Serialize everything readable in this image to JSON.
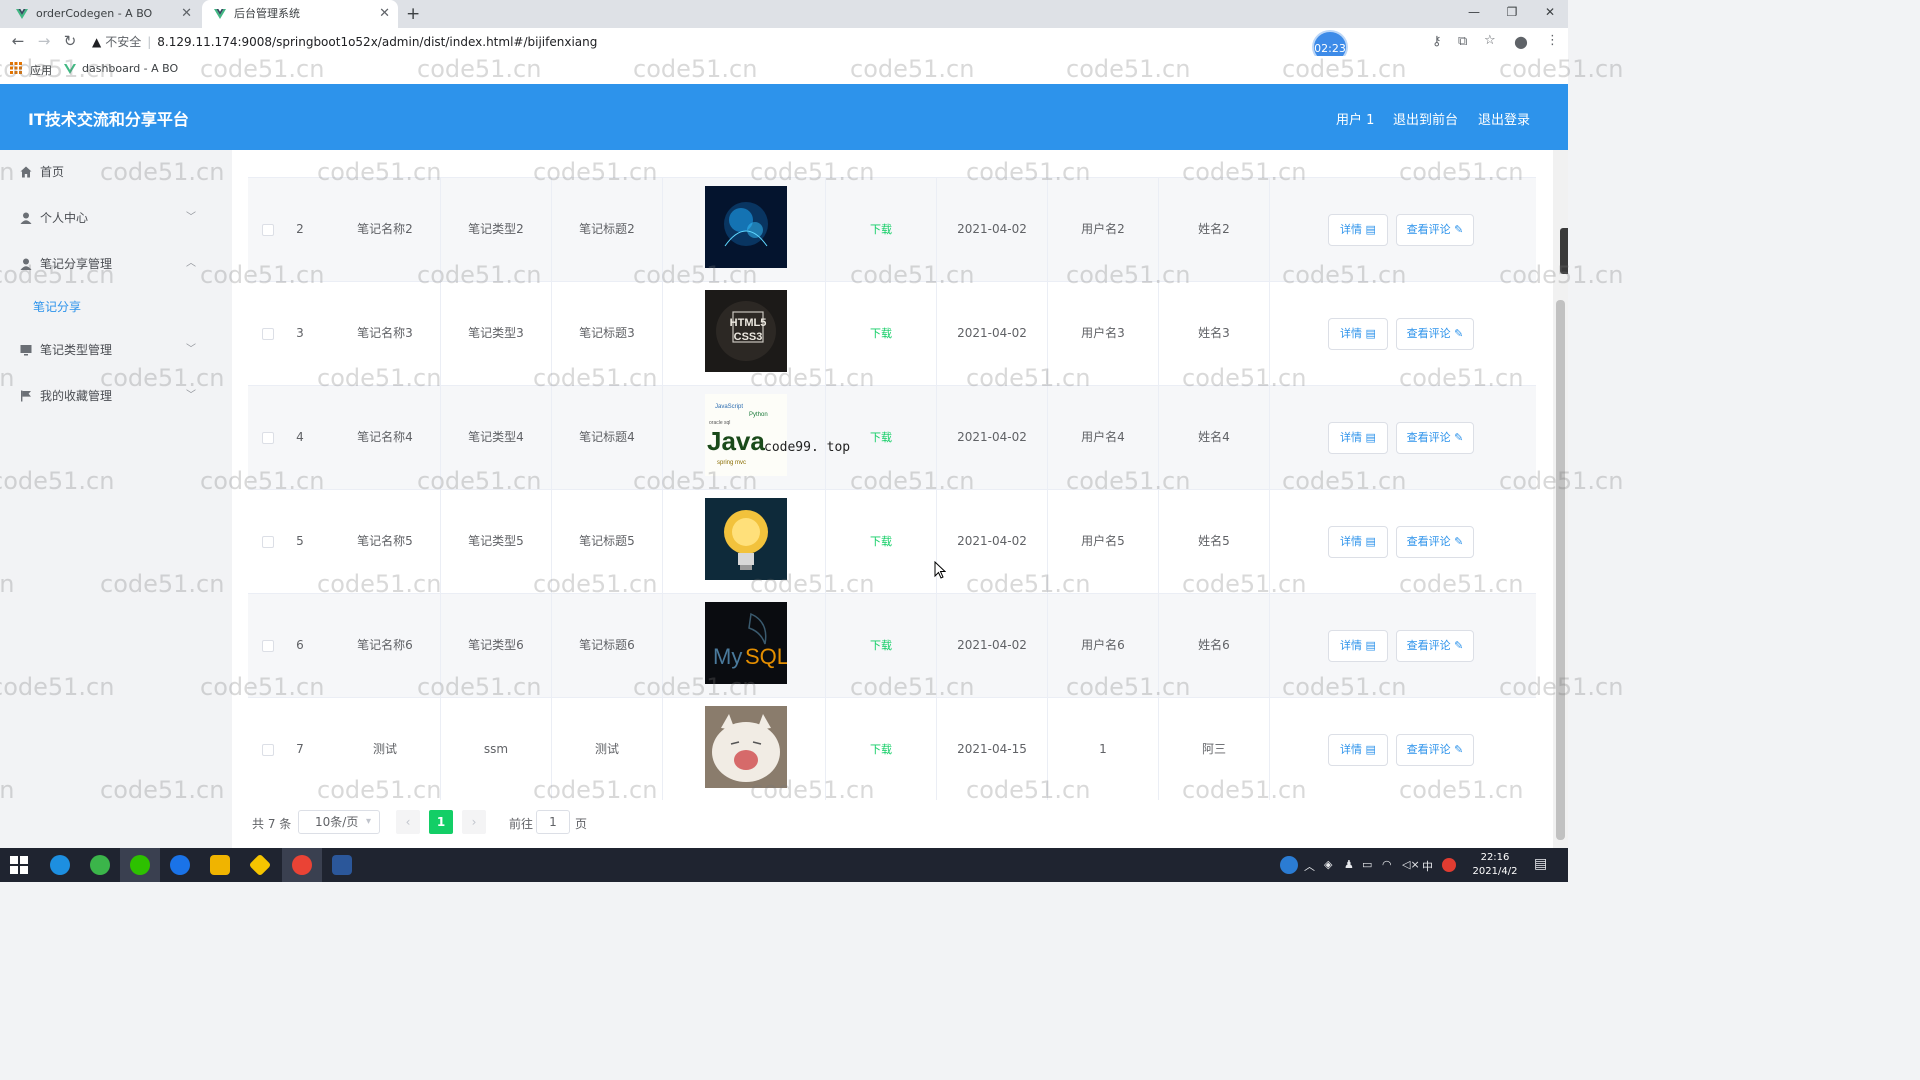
{
  "browser": {
    "tabs": [
      {
        "title": "orderCodegen - A BO",
        "active": false
      },
      {
        "title": "后台管理系统",
        "active": true
      }
    ],
    "new_tab": "+",
    "url_warning": "不安全",
    "url": "8.129.11.174:9008/springboot1o52x/admin/dist/index.html#/bijifenxiang",
    "timer": "02:23",
    "bookmarks": [
      {
        "label": "应用",
        "icon": "apps-grid-icon"
      },
      {
        "label": "dashboard - A BO",
        "icon": "vue-logo-icon"
      }
    ]
  },
  "header": {
    "title": "IT技术交流和分享平台",
    "links": [
      "用户 1",
      "退出到前台",
      "退出登录"
    ]
  },
  "sidebar": {
    "items": [
      {
        "label": "首页",
        "icon": "home-icon",
        "expandable": false
      },
      {
        "label": "个人中心",
        "icon": "user-icon",
        "expandable": true
      },
      {
        "label": "笔记分享管理",
        "icon": "user-icon",
        "expandable": true,
        "expanded": true
      },
      {
        "label": "笔记分享",
        "submenu": true,
        "active": true
      },
      {
        "label": "笔记类型管理",
        "icon": "monitor-icon",
        "expandable": true
      },
      {
        "label": "我的收藏管理",
        "icon": "flag-icon",
        "expandable": true
      }
    ]
  },
  "table": {
    "download_label": "下载",
    "detail_label": "详情",
    "comment_label": "查看评论",
    "rows": [
      {
        "index": "2",
        "name": "笔记名称2",
        "type": "笔记类型2",
        "title": "笔记标题2",
        "image": "ai-brain",
        "date": "2021-04-02",
        "username": "用户名2",
        "realname": "姓名2"
      },
      {
        "index": "3",
        "name": "笔记名称3",
        "type": "笔记类型3",
        "title": "笔记标题3",
        "image": "html5-css3",
        "date": "2021-04-02",
        "username": "用户名3",
        "realname": "姓名3"
      },
      {
        "index": "4",
        "name": "笔记名称4",
        "type": "笔记类型4",
        "title": "笔记标题4",
        "image": "java-wordcloud",
        "date": "2021-04-02",
        "username": "用户名4",
        "realname": "姓名4"
      },
      {
        "index": "5",
        "name": "笔记名称5",
        "type": "笔记类型5",
        "title": "笔记标题5",
        "image": "lightbulb",
        "date": "2021-04-02",
        "username": "用户名5",
        "realname": "姓名5"
      },
      {
        "index": "6",
        "name": "笔记名称6",
        "type": "笔记类型6",
        "title": "笔记标题6",
        "image": "mysql",
        "date": "2021-04-02",
        "username": "用户名6",
        "realname": "姓名6"
      },
      {
        "index": "7",
        "name": "测试",
        "type": "ssm",
        "title": "测试",
        "image": "cat-photo",
        "date": "2021-04-15",
        "username": "1",
        "realname": "阿三"
      }
    ]
  },
  "pagination": {
    "total": "共 7 条",
    "page_size": "10条/页",
    "current_page": "1",
    "goto_label": "前往",
    "goto_value": "1",
    "goto_unit": "页"
  },
  "overlay_text": "code99. top",
  "watermark": "code51.cn",
  "taskbar": {
    "time": "22:16",
    "date": "2021/4/2",
    "tray": [
      "中"
    ]
  }
}
